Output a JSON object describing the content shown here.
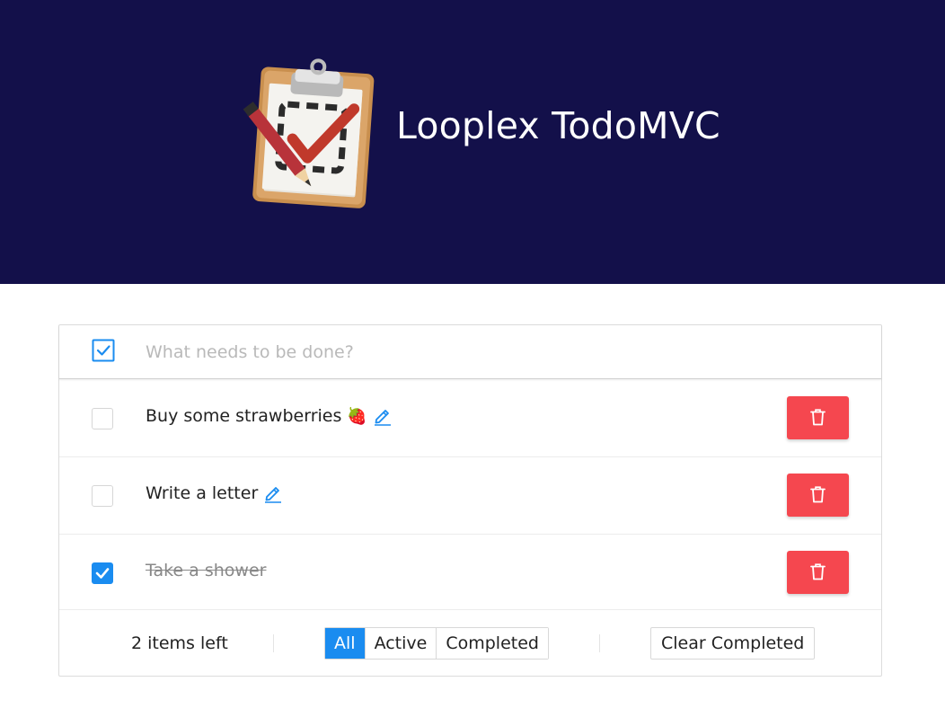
{
  "header": {
    "title": "Looplex TodoMVC",
    "logo_icon": "clipboard-check-pencil-icon",
    "background": "#13104a"
  },
  "new_todo": {
    "placeholder": "What needs to be done?",
    "value": "",
    "toggle_all_icon": "checkbox-checked-outline-icon"
  },
  "todos": [
    {
      "text": "Buy some strawberries",
      "emoji": "🍓",
      "completed": false,
      "edit_icon": "pencil-icon",
      "delete_icon": "trash-icon"
    },
    {
      "text": "Write a letter",
      "completed": false,
      "edit_icon": "pencil-icon",
      "delete_icon": "trash-icon"
    },
    {
      "text": "Take a shower",
      "completed": true,
      "delete_icon": "trash-icon"
    }
  ],
  "footer": {
    "items_left": "2 items left",
    "filters": [
      {
        "label": "All",
        "active": true
      },
      {
        "label": "Active",
        "active": false
      },
      {
        "label": "Completed",
        "active": false
      }
    ],
    "clear_label": "Clear Completed"
  },
  "colors": {
    "accent": "#1a8cf0",
    "danger": "#f5474f",
    "header_bg": "#13104a"
  }
}
